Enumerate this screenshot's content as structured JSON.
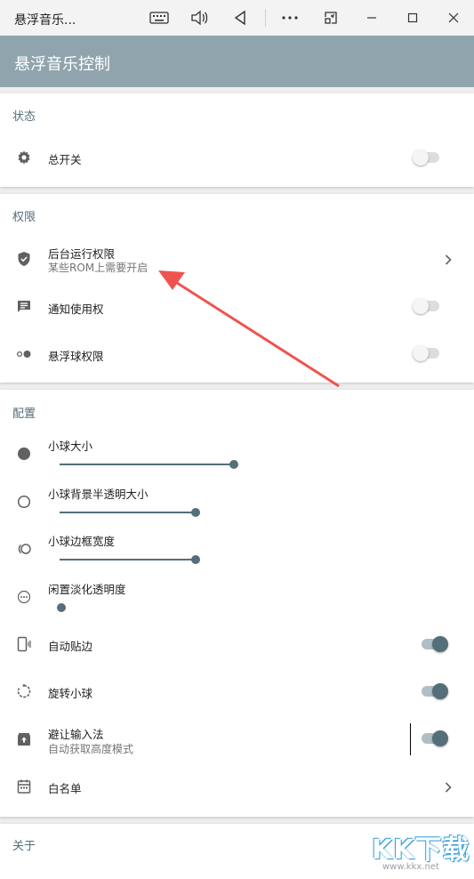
{
  "window": {
    "title": "悬浮音乐...",
    "icons": [
      "keyboard-icon",
      "volume-icon",
      "back-icon",
      "more-icon",
      "compact-mode-icon",
      "minimize-icon",
      "maximize-icon",
      "close-icon"
    ]
  },
  "appbar": {
    "title": "悬浮音乐控制",
    "color": "#90a4ae"
  },
  "sections": {
    "status": {
      "title": "状态",
      "master_switch": {
        "label": "总开关",
        "enabled": false
      }
    },
    "permissions": {
      "title": "权限",
      "background": {
        "label": "后台运行权限",
        "sub": "某些ROM上需要开启"
      },
      "notification": {
        "label": "通知使用权",
        "enabled": false
      },
      "float_ball": {
        "label": "悬浮球权限",
        "enabled": false
      }
    },
    "config": {
      "title": "配置",
      "ball_size": {
        "label": "小球大小",
        "value": 0.9
      },
      "ball_bg_alpha": {
        "label": "小球背景半透明大小",
        "value": 0.7
      },
      "ball_border": {
        "label": "小球边框宽度",
        "value": 0.7
      },
      "idle_fade": {
        "label": "闲置淡化透明度",
        "value": 0.0
      },
      "auto_edge": {
        "label": "自动贴边",
        "enabled": true
      },
      "rotate_ball": {
        "label": "旋转小球",
        "enabled": true
      },
      "avoid_ime": {
        "label": "避让输入法",
        "sub": "自动获取高度模式",
        "enabled": true
      },
      "whitelist": {
        "label": "白名单"
      }
    },
    "about": {
      "title": "关于"
    }
  },
  "watermark": {
    "brand": "KK下载",
    "url": "www.kkx.net"
  },
  "colors": {
    "accent": "#546e7a",
    "annotation_arrow": "#ef5350"
  }
}
